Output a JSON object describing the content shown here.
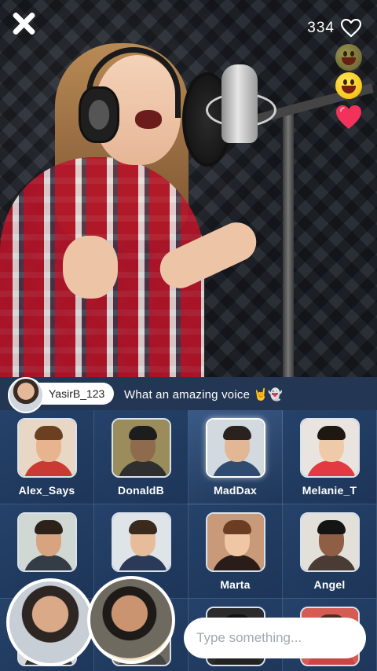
{
  "stage": {
    "like_count": "334"
  },
  "comment": {
    "username": "YasirB_123",
    "text": "What an amazing voice 🤘👻"
  },
  "participants": [
    {
      "name": "Alex_Says",
      "active": false,
      "colors": {
        "bg": "#e8d7c4",
        "skin": "#e7b48f",
        "hair": "#6a3f22",
        "body": "#c93b32"
      }
    },
    {
      "name": "DonaldB",
      "active": false,
      "colors": {
        "bg": "#9b8c5b",
        "skin": "#8f6b4e",
        "hair": "#1d1d1d",
        "body": "#2f2f2f"
      }
    },
    {
      "name": "MadDax",
      "active": true,
      "colors": {
        "bg": "#d2d9df",
        "skin": "#e2b796",
        "hair": "#2a221e",
        "body": "#2f4b6f"
      }
    },
    {
      "name": "Melanie_T",
      "active": false,
      "colors": {
        "bg": "#e9e4df",
        "skin": "#efcaa8",
        "hair": "#1f1712",
        "body": "#e23a40"
      }
    },
    {
      "name": "",
      "active": false,
      "colors": {
        "bg": "#cfd8d2",
        "skin": "#d8a47f",
        "hair": "#2c221a",
        "body": "#343c46"
      }
    },
    {
      "name": "",
      "active": false,
      "colors": {
        "bg": "#dfe4e8",
        "skin": "#e6bc9a",
        "hair": "#3a2a1e",
        "body": "#2b3a58"
      }
    },
    {
      "name": "Marta",
      "active": false,
      "colors": {
        "bg": "#c99a79",
        "skin": "#f0c7a4",
        "hair": "#6b3d22",
        "body": "#2a1c18"
      }
    },
    {
      "name": "Angel",
      "active": false,
      "colors": {
        "bg": "#e3e0da",
        "skin": "#8e5f45",
        "hair": "#141414",
        "body": "#4a3b34"
      }
    },
    {
      "name": "",
      "active": false,
      "colors": {
        "bg": "#d8d8d8",
        "skin": "#d9a988",
        "hair": "#2d2622",
        "body": "#333"
      }
    },
    {
      "name": "",
      "active": false,
      "colors": {
        "bg": "#6f6a60",
        "skin": "#c9946f",
        "hair": "#1e1a18",
        "body": "#444"
      }
    },
    {
      "name": "",
      "active": false,
      "colors": {
        "bg": "#2b2b2b",
        "skin": "#e0b08e",
        "hair": "#111",
        "body": "#222"
      }
    },
    {
      "name": "",
      "active": false,
      "colors": {
        "bg": "#d65b53",
        "skin": "#f0c7a4",
        "hair": "#4b2f20",
        "body": "#c44"
      }
    }
  ],
  "chat": {
    "placeholder": "Type something..."
  },
  "accent_colors": {
    "heart": "#f2325a",
    "grid_bg": "#21395c"
  },
  "icons": [
    "close-icon",
    "heart-outline-icon",
    "grinning-emoji-icon",
    "smiling-emoji-icon",
    "heart-icon"
  ]
}
